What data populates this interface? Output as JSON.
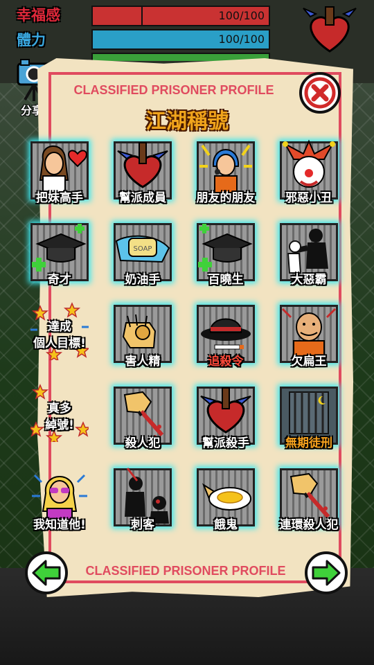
{
  "stats": [
    {
      "label": "幸福感",
      "value": "100/100",
      "color": "#c93232",
      "fill": 1.0
    },
    {
      "label": "體力",
      "value": "100/100",
      "color": "#2a9fc7",
      "fill": 1.0
    }
  ],
  "share_label": "分享",
  "header": {
    "title": "CLASSIFIED PRISONER PROFILE",
    "close_icon": "close-x-icon"
  },
  "section_title": "江湖稱號",
  "titles": [
    {
      "label": "把妹高手",
      "icon": "woman-heart-icon"
    },
    {
      "label": "幫派成員",
      "icon": "winged-heart-icon"
    },
    {
      "label": "朋友的朋友",
      "icon": "singer-icon"
    },
    {
      "label": "邪惡小丑",
      "icon": "evil-clown-icon"
    },
    {
      "label": "奇才",
      "icon": "grad-cap-icon"
    },
    {
      "label": "奶油手",
      "icon": "soap-icon"
    },
    {
      "label": "百曉生",
      "icon": "grad-cap-icon"
    },
    {
      "label": "大惡霸",
      "icon": "bully-icon"
    },
    {
      "label": "達成\n個人目標!",
      "icon": "stars-icon"
    },
    {
      "label": "害人精",
      "icon": "pointing-hand-icon"
    },
    {
      "label": "追殺令",
      "icon": "fedora-icon"
    },
    {
      "label": "欠扁王",
      "icon": "bald-prisoner-icon"
    },
    {
      "label": "真多\n綽號!",
      "icon": "stars-icon"
    },
    {
      "label": "殺人犯",
      "icon": "bloody-fist-icon"
    },
    {
      "label": "幫派殺手",
      "icon": "winged-heart-icon"
    },
    {
      "label": "無期徒刑",
      "icon": "jail-cell-icon"
    },
    {
      "label": "我知道他!",
      "icon": "blonde-woman-icon"
    },
    {
      "label": "刺客",
      "icon": "assassin-icon"
    },
    {
      "label": "餓鬼",
      "icon": "food-plate-icon"
    },
    {
      "label": "連環殺人犯",
      "icon": "bloody-fist-icon"
    }
  ],
  "soap_text": "SOAP",
  "footer": {
    "title": "CLASSIFIED PRISONER PROFILE",
    "prev_icon": "arrow-left-icon",
    "next_icon": "arrow-right-icon"
  },
  "colors": {
    "accent_red": "#e04b5f",
    "title_orange": "#f0a41c",
    "arrow_green": "#3fd13a",
    "tile_glow": "#3ee6ef"
  }
}
